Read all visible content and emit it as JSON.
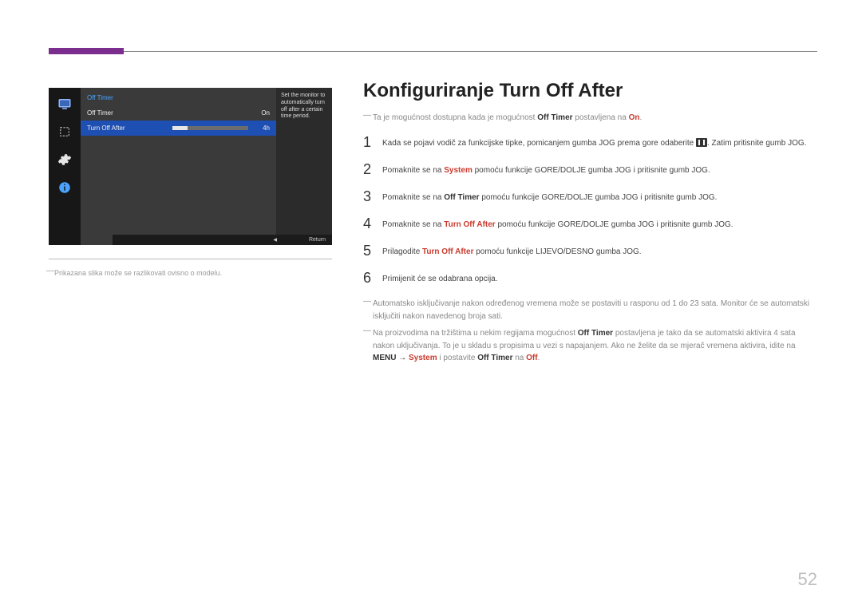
{
  "page_number": "52",
  "screenshot": {
    "menu_header": "Off Timer",
    "rows": [
      {
        "label": "Off Timer",
        "value": "On"
      },
      {
        "label": "Turn Off After",
        "value": "4h"
      }
    ],
    "description": "Set the monitor to automatically turn off after a certain time period.",
    "return_label": "Return"
  },
  "image_note": "Prikazana slika može se razlikovati ovisno o modelu.",
  "title": "Konfiguriranje Turn Off After",
  "top_note": {
    "pre": "Ta je mogućnost dostupna kada je mogućnost ",
    "b1": "Off Timer",
    "mid": " postavljena na ",
    "r1": "On",
    "post": "."
  },
  "steps": [
    {
      "num": "1",
      "parts": {
        "pre": "Kada se pojavi vodič za funkcijske tipke, pomicanjem gumba JOG prema gore odaberite ",
        "post": ". Zatim pritisnite gumb JOG."
      }
    },
    {
      "num": "2",
      "parts": {
        "pre": "Pomaknite se na ",
        "r1": "System",
        "post": " pomoću funkcije GORE/DOLJE gumba JOG i pritisnite gumb JOG."
      }
    },
    {
      "num": "3",
      "parts": {
        "pre": "Pomaknite se na ",
        "b1": "Off Timer",
        "post": " pomoću funkcije GORE/DOLJE gumba JOG i pritisnite gumb JOG."
      }
    },
    {
      "num": "4",
      "parts": {
        "pre": "Pomaknite se na ",
        "r1": "Turn Off After",
        "post": " pomoću funkcije GORE/DOLJE gumba JOG i pritisnite gumb JOG."
      }
    },
    {
      "num": "5",
      "parts": {
        "pre": "Prilagodite ",
        "r1": "Turn Off After",
        "post": " pomoću funkcije LIJEVO/DESNO gumba JOG."
      }
    },
    {
      "num": "6",
      "parts": {
        "pre": "Primijenit će se odabrana opcija."
      }
    }
  ],
  "bottom_notes": {
    "n1": "Automatsko isključivanje nakon određenog vremena može se postaviti u rasponu od 1 do 23 sata. Monitor će se automatski isključiti nakon navedenog broja sati.",
    "n2": {
      "a": "Na proizvodima na tržištima u nekim regijama mogućnost ",
      "b1": "Off Timer",
      "b": " postavljena je tako da se automatski aktivira 4 sata nakon uključivanja. To je u skladu s propisima u vezi s napajanjem. Ako ne želite da se mjerač vremena aktivira, idite na ",
      "b2": "MENU",
      "arrow": " → ",
      "r1": "System",
      "c": " i postavite ",
      "b3": "Off Timer",
      "d": " na ",
      "r2": "Off",
      "e": "."
    }
  }
}
